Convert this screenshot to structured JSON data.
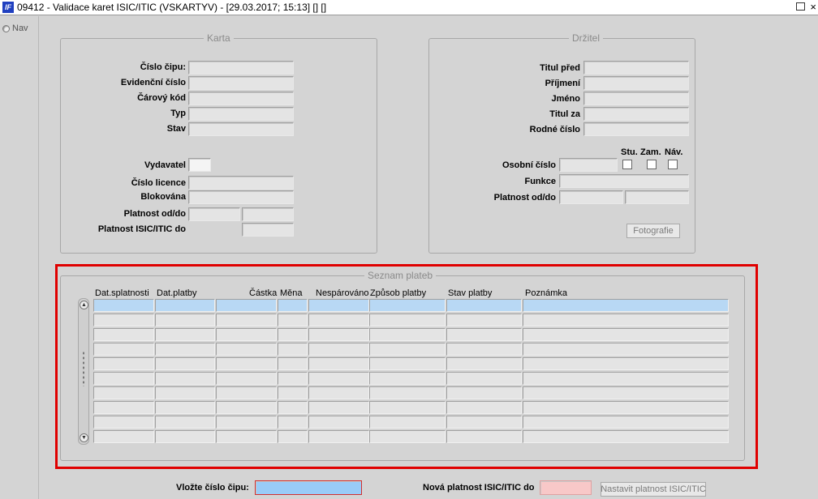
{
  "window": {
    "title": "09412 - Validace karet ISIC/ITIC (VSKARTYV) - [29.03.2017; 15:13]  []  []",
    "icon_text": "IF",
    "close_glyph": "×"
  },
  "sidebar": {
    "nav_label": "Nav"
  },
  "karta": {
    "title": "Karta",
    "labels": {
      "cislo_cipu": "Číslo čipu:",
      "evidencni_cislo": "Evidenční číslo",
      "carovy_kod": "Čárový kód",
      "typ": "Typ",
      "stav": "Stav",
      "vydavatel": "Vydavatel",
      "cislo_licence": "Číslo licence",
      "blokovana": "Blokována",
      "platnost_od_do": "Platnost od/do",
      "platnost_isic_do": "Platnost ISIC/ITIC do"
    }
  },
  "drzitel": {
    "title": "Držitel",
    "labels": {
      "titul_pred": "Titul před",
      "prijmeni": "Příjmení",
      "jmeno": "Jméno",
      "titul_za": "Titul za",
      "rodne_cislo": "Rodné číslo",
      "osobni_cislo": "Osobní číslo",
      "funkce": "Funkce",
      "platnost_od_do": "Platnost od/do"
    },
    "checkbox_labels": {
      "stu": "Stu.",
      "zam": "Zam.",
      "nav": "Náv."
    },
    "photo_button": "Fotografie"
  },
  "payments": {
    "title": "Seznam plateb",
    "columns": {
      "dat_splatnosti": "Dat.splatnosti",
      "dat_platby": "Dat.platby",
      "castka": "Částka",
      "mena": "Měna",
      "nesparovano": "Nespárováno",
      "zpusob_platby": "Způsob platby",
      "stav_platby": "Stav platby",
      "poznamka": "Poznámka"
    }
  },
  "footer": {
    "chip_label": "Vložte číslo čipu:",
    "new_validity_label": "Nová platnost ISIC/ITIC do",
    "set_validity_button": "Nastavit platnost ISIC/ITIC"
  },
  "colors": {
    "highlight_blue": "#99ccf8",
    "highlight_pink": "#f8c8c8",
    "frame_red": "#e00000"
  }
}
